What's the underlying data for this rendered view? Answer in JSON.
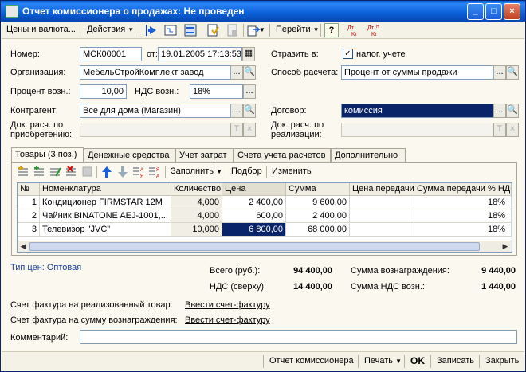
{
  "window": {
    "title": "Отчет комиссионера о продажах: Не проведен",
    "min_label": "_",
    "max_label": "□",
    "close_label": "×"
  },
  "toolbar": {
    "prices_label": "Цены и валюта...",
    "actions_label": "Действия",
    "navigate_label": "Перейти",
    "help_label": "?"
  },
  "header": {
    "number_label": "Номер:",
    "number_value": "МСК00001",
    "date_label": "от:",
    "date_value": "19.01.2005 17:13:53",
    "reflect_label": "Отразить в:",
    "tax_accounting_label": "налог. учете",
    "tax_accounting_checked": "✓",
    "org_label": "Организация:",
    "org_value": "МебельСтройКомплект завод",
    "calc_method_label": "Способ расчета:",
    "calc_method_value": "Процент от суммы продажи",
    "reward_percent_label": "Процент возн.:",
    "reward_percent_value": "10,00",
    "vat_reward_label": "НДС возн.:",
    "vat_reward_value": "18%",
    "counterparty_label": "Контрагент:",
    "counterparty_value": "Все для дома (Магазин)",
    "contract_label": "Договор:",
    "contract_value": "комиссия",
    "doc_purchase_label_1": "Док. расч. по",
    "doc_purchase_label_2": "приобретению:",
    "doc_purchase_value": "",
    "doc_sale_label_1": "Док. расч. по",
    "doc_sale_label_2": "реализации:",
    "doc_sale_value": ""
  },
  "tabs": [
    {
      "label": "Товары (3 поз.)"
    },
    {
      "label": "Денежные средства"
    },
    {
      "label": "Учет затрат"
    },
    {
      "label": "Счета учета расчетов"
    },
    {
      "label": "Дополнительно"
    }
  ],
  "grid_toolbar": {
    "fill_label": "Заполнить",
    "select_label": "Подбор",
    "change_label": "Изменить"
  },
  "table": {
    "columns": [
      "№",
      "Номенклатура",
      "Количество",
      "Цена",
      "Сумма",
      "Цена передачи",
      "Сумма передачи",
      "% НДС"
    ],
    "rows": [
      {
        "n": "1",
        "name": "Кондиционер FIRMSTAR 12M",
        "qty": "4,000",
        "price": "2 400,00",
        "sum": "9 600,00",
        "tprice": "",
        "tsum": "",
        "vat": "18%"
      },
      {
        "n": "2",
        "name": "Чайник BINATONE  AEJ-1001,...",
        "qty": "4,000",
        "price": "600,00",
        "sum": "2 400,00",
        "tprice": "",
        "tsum": "",
        "vat": "18%"
      },
      {
        "n": "3",
        "name": "Телевизор \"JVC\"",
        "qty": "10,000",
        "price": "6 800,00",
        "sum": "68 000,00",
        "tprice": "",
        "tsum": "",
        "vat": "18%"
      }
    ]
  },
  "totals": {
    "price_type_label": "Тип цен: Оптовая",
    "total_label": "Всего (руб.):",
    "total_value": "94 400,00",
    "vat_label": "НДС (сверху):",
    "vat_value": "14 400,00",
    "reward_sum_label": "Сумма вознаграждения:",
    "reward_sum_value": "9 440,00",
    "reward_vat_label": "Сумма НДС возн.:",
    "reward_vat_value": "1 440,00"
  },
  "invoices": {
    "sold_goods_label": "Счет фактура на реализованный товар:",
    "sold_goods_link": "Ввести счет-фактуру",
    "reward_label": "Счет фактура на сумму вознаграждения:",
    "reward_link": "Ввести счет-фактуру",
    "comment_label": "Комментарий:",
    "comment_value": ""
  },
  "bottom": {
    "report_label": "Отчет комиссионера",
    "print_label": "Печать",
    "ok_label": "OK",
    "save_label": "Записать",
    "close_label": "Закрыть"
  },
  "colors": {
    "title_bar": "#0a5fd8",
    "selection": "#0a246a",
    "background": "#fbf9ef"
  }
}
